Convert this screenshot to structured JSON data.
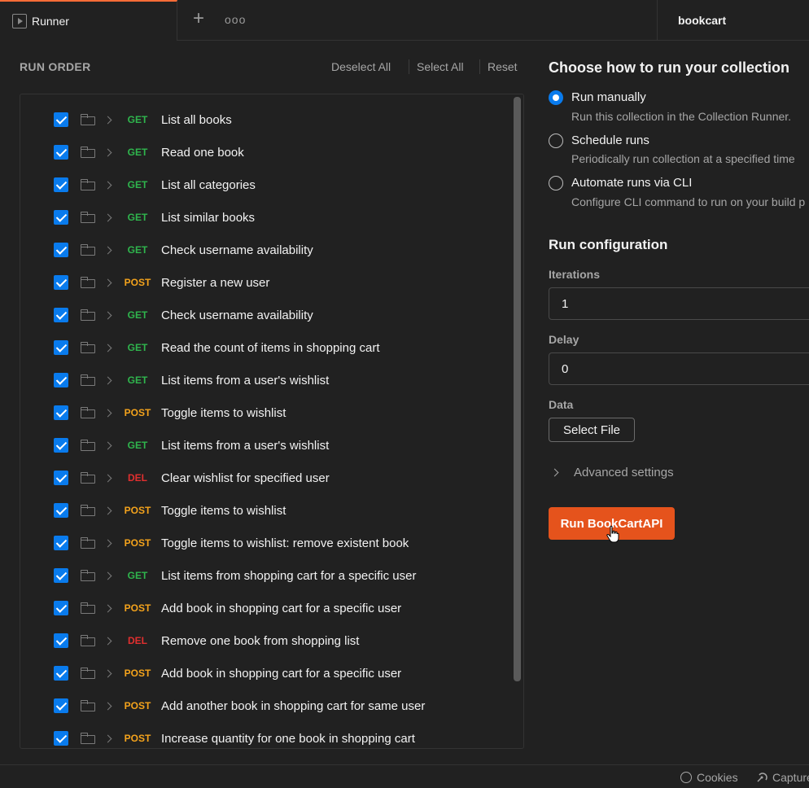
{
  "tabs": {
    "runner_label": "Runner",
    "new_tab_label": "+",
    "more_label": "ooo",
    "collection_label": "bookcart"
  },
  "run_order": {
    "heading": "RUN ORDER",
    "deselect_all": "Deselect All",
    "select_all": "Select All",
    "reset": "Reset",
    "requests": [
      {
        "method": "GET",
        "name": "List all books",
        "checked": true
      },
      {
        "method": "GET",
        "name": "Read one book",
        "checked": true
      },
      {
        "method": "GET",
        "name": "List all categories",
        "checked": true
      },
      {
        "method": "GET",
        "name": "List similar books",
        "checked": true
      },
      {
        "method": "GET",
        "name": "Check username availability",
        "checked": true
      },
      {
        "method": "POST",
        "name": "Register a new user",
        "checked": true
      },
      {
        "method": "GET",
        "name": "Check username availability",
        "checked": true
      },
      {
        "method": "GET",
        "name": "Read the count of items in shopping cart",
        "checked": true
      },
      {
        "method": "GET",
        "name": "List items from a user's wishlist",
        "checked": true
      },
      {
        "method": "POST",
        "name": "Toggle items to wishlist",
        "checked": true
      },
      {
        "method": "GET",
        "name": "List items from a user's wishlist",
        "checked": true
      },
      {
        "method": "DEL",
        "name": "Clear wishlist for specified user",
        "checked": true
      },
      {
        "method": "POST",
        "name": "Toggle items to wishlist",
        "checked": true
      },
      {
        "method": "POST",
        "name": "Toggle items to wishlist: remove existent book",
        "checked": true
      },
      {
        "method": "GET",
        "name": "List items from shopping cart for a specific user",
        "checked": true
      },
      {
        "method": "POST",
        "name": "Add book in shopping cart for a specific user",
        "checked": true
      },
      {
        "method": "DEL",
        "name": "Remove one book from shopping list",
        "checked": true
      },
      {
        "method": "POST",
        "name": "Add book in shopping cart for a specific user",
        "checked": true
      },
      {
        "method": "POST",
        "name": "Add another book in shopping cart for same user",
        "checked": true
      },
      {
        "method": "POST",
        "name": "Increase quantity for one book in shopping cart",
        "checked": true
      }
    ]
  },
  "run_options": {
    "heading": "Choose how to run your collection",
    "options": [
      {
        "label": "Run manually",
        "description": "Run this collection in the Collection Runner.",
        "selected": true
      },
      {
        "label": "Schedule runs",
        "description": "Periodically run collection at a specified time",
        "selected": false
      },
      {
        "label": "Automate runs via CLI",
        "description": "Configure CLI command to run on your build p",
        "selected": false
      }
    ]
  },
  "config": {
    "heading": "Run configuration",
    "iterations_label": "Iterations",
    "iterations_value": "1",
    "delay_label": "Delay",
    "delay_value": "0",
    "data_label": "Data",
    "select_file_label": "Select File",
    "advanced_label": "Advanced settings",
    "run_button_label": "Run BookCartAPI"
  },
  "statusbar": {
    "cookies_label": "Cookies",
    "capture_label": "Capture"
  },
  "colors": {
    "accent": "#ff6c37",
    "run_button": "#e5531c",
    "checkbox": "#097bed",
    "get": "#2fb54d",
    "post": "#f4a31c",
    "del": "#e12f2f"
  }
}
